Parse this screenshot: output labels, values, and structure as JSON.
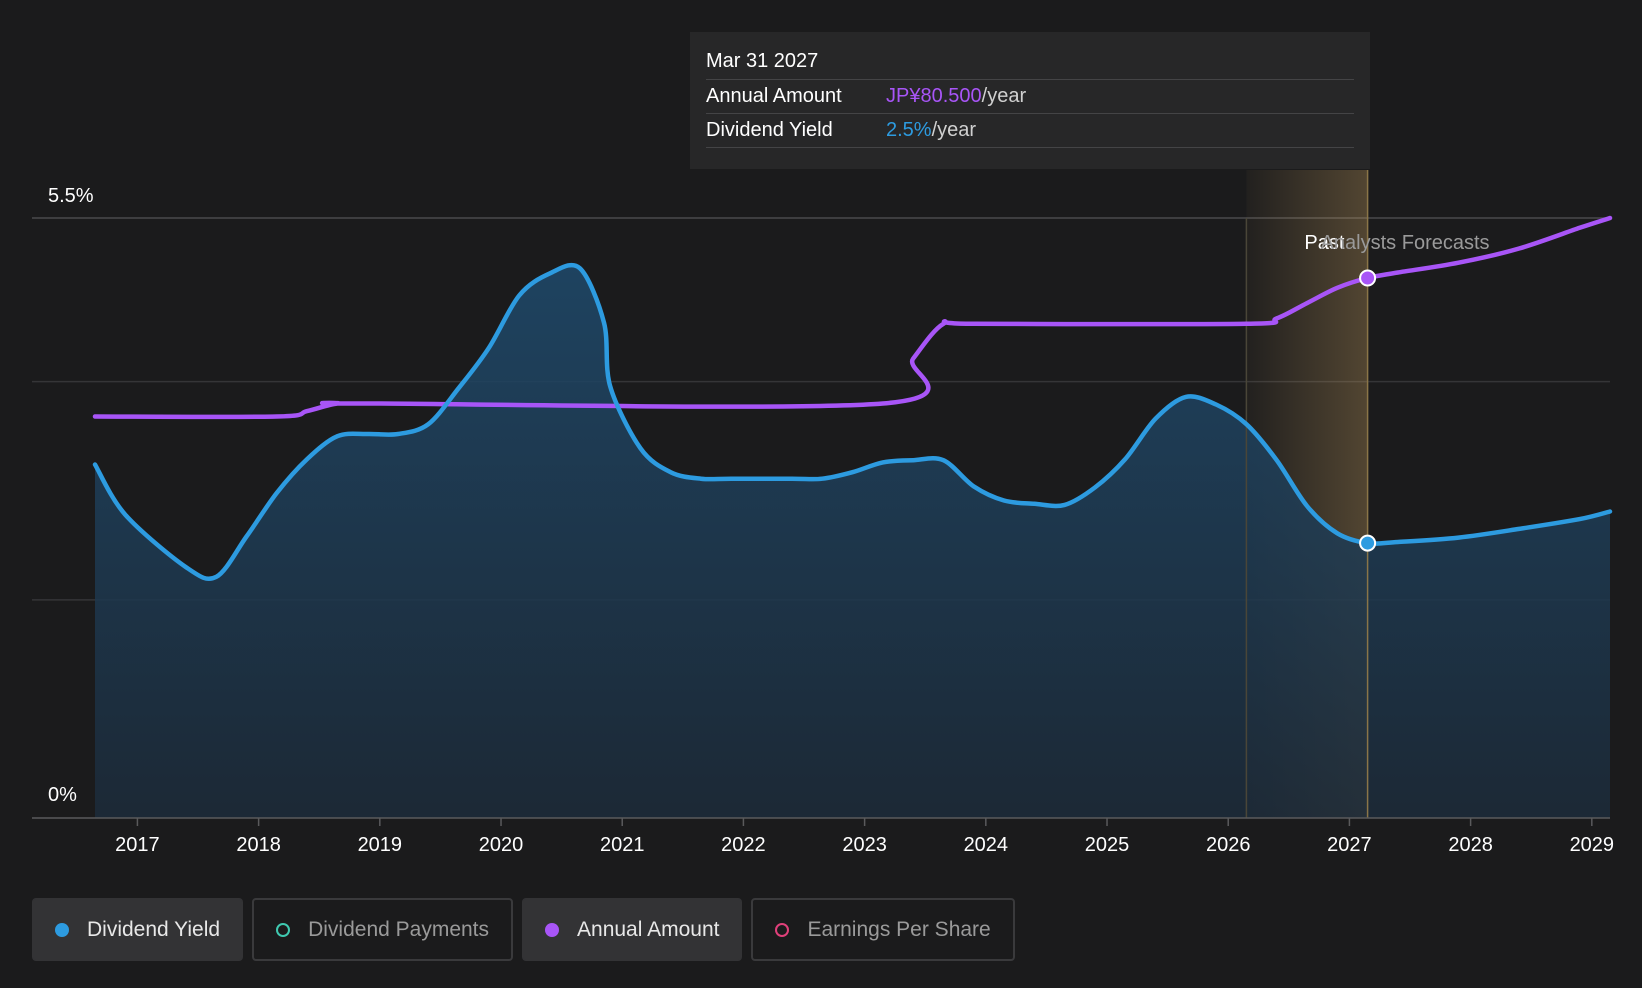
{
  "tooltip": {
    "date": "Mar 31 2027",
    "annual_amount_label": "Annual Amount",
    "annual_amount_value": "JP¥80.500",
    "annual_amount_unit": "/year",
    "dividend_yield_label": "Dividend Yield",
    "dividend_yield_value": "2.5%",
    "dividend_yield_unit": "/year"
  },
  "legend": {
    "items": [
      {
        "label": "Dividend Yield",
        "active": true,
        "color": "#2d9be0"
      },
      {
        "label": "Dividend Payments",
        "active": false,
        "color": "#3fc9b0"
      },
      {
        "label": "Annual Amount",
        "active": true,
        "color": "#a855f7"
      },
      {
        "label": "Earnings Per Share",
        "active": false,
        "color": "#e0407a"
      }
    ]
  },
  "chart_data": {
    "type": "line",
    "y_top_label": "5.5%",
    "y_bottom_label": "0%",
    "ylim": [
      0,
      5.5
    ],
    "xlim": [
      2016.75,
      2029.25
    ],
    "x_ticks": [
      "2017",
      "2018",
      "2019",
      "2020",
      "2021",
      "2022",
      "2023",
      "2024",
      "2025",
      "2026",
      "2027",
      "2028",
      "2029"
    ],
    "past_label": "Past",
    "forecast_label": "Analysts Forecasts",
    "forecast_start": 2026.25,
    "current": 2027.25,
    "colors": {
      "yield": "#2d9be0",
      "annual": "#a855f7",
      "highlight": "#c8a060"
    },
    "series": [
      {
        "name": "Dividend Yield",
        "color": "#2d9be0",
        "unit": "%",
        "points": [
          [
            2016.75,
            3.24
          ],
          [
            2017.0,
            2.78
          ],
          [
            2017.5,
            2.3
          ],
          [
            2017.75,
            2.21
          ],
          [
            2018.0,
            2.58
          ],
          [
            2018.25,
            2.98
          ],
          [
            2018.5,
            3.29
          ],
          [
            2018.75,
            3.5
          ],
          [
            2019.0,
            3.52
          ],
          [
            2019.25,
            3.52
          ],
          [
            2019.5,
            3.61
          ],
          [
            2019.75,
            3.94
          ],
          [
            2020.0,
            4.31
          ],
          [
            2020.25,
            4.79
          ],
          [
            2020.5,
            4.99
          ],
          [
            2020.75,
            5.04
          ],
          [
            2020.95,
            4.54
          ],
          [
            2021.0,
            3.96
          ],
          [
            2021.25,
            3.39
          ],
          [
            2021.5,
            3.17
          ],
          [
            2021.75,
            3.11
          ],
          [
            2022.0,
            3.11
          ],
          [
            2022.5,
            3.11
          ],
          [
            2022.75,
            3.11
          ],
          [
            2023.0,
            3.17
          ],
          [
            2023.25,
            3.26
          ],
          [
            2023.5,
            3.28
          ],
          [
            2023.75,
            3.28
          ],
          [
            2024.0,
            3.04
          ],
          [
            2024.25,
            2.91
          ],
          [
            2024.5,
            2.88
          ],
          [
            2024.75,
            2.87
          ],
          [
            2025.0,
            3.03
          ],
          [
            2025.25,
            3.29
          ],
          [
            2025.5,
            3.66
          ],
          [
            2025.75,
            3.86
          ],
          [
            2026.0,
            3.79
          ],
          [
            2026.25,
            3.61
          ],
          [
            2026.5,
            3.28
          ],
          [
            2026.75,
            2.86
          ],
          [
            2027.0,
            2.61
          ],
          [
            2027.25,
            2.52
          ],
          [
            2027.5,
            2.53
          ],
          [
            2028.0,
            2.57
          ],
          [
            2028.5,
            2.65
          ],
          [
            2029.0,
            2.74
          ],
          [
            2029.25,
            2.81
          ]
        ]
      },
      {
        "name": "Annual Amount",
        "color": "#a855f7",
        "unit": "JP¥",
        "points": [
          [
            2016.75,
            3.68
          ],
          [
            2018.25,
            3.68
          ],
          [
            2018.5,
            3.73
          ],
          [
            2018.75,
            3.8
          ],
          [
            2019.0,
            3.8
          ],
          [
            2023.25,
            3.8
          ],
          [
            2023.5,
            4.21
          ],
          [
            2023.75,
            4.53
          ],
          [
            2024.0,
            4.53
          ],
          [
            2026.25,
            4.53
          ],
          [
            2026.5,
            4.58
          ],
          [
            2026.75,
            4.72
          ],
          [
            2027.0,
            4.86
          ],
          [
            2027.25,
            4.95
          ],
          [
            2027.5,
            5.0
          ],
          [
            2028.0,
            5.09
          ],
          [
            2028.5,
            5.22
          ],
          [
            2029.0,
            5.41
          ],
          [
            2029.25,
            5.5
          ]
        ]
      }
    ],
    "markers": [
      {
        "series": "Annual Amount",
        "x": 2027.25,
        "y": 4.95
      },
      {
        "series": "Dividend Yield",
        "x": 2027.25,
        "y": 2.52
      }
    ]
  }
}
